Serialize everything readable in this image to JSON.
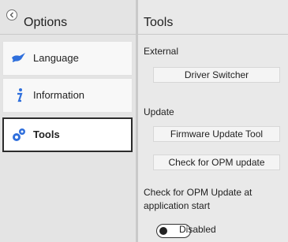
{
  "sidebar": {
    "header": {
      "title": "Options"
    },
    "items": [
      {
        "label": "Language",
        "icon": "language-icon"
      },
      {
        "label": "Information",
        "icon": "info-icon"
      },
      {
        "label": "Tools",
        "icon": "tools-icon",
        "selected": true
      }
    ]
  },
  "content": {
    "title": "Tools",
    "external": {
      "label": "External",
      "button": "Driver Switcher"
    },
    "update": {
      "label": "Update",
      "buttons": [
        "Firmware Update Tool",
        "Check for OPM update"
      ]
    },
    "auto_check": {
      "label": "Check for OPM Update at application start",
      "toggle_state": "Disabled"
    }
  },
  "colors": {
    "accent_blue": "#2f6fdc",
    "selection_border": "#2c2c2c"
  }
}
